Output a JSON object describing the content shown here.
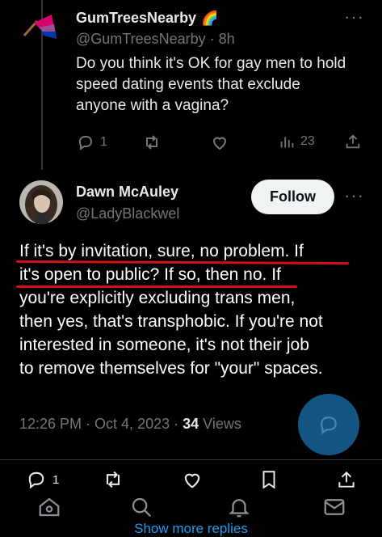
{
  "parent_tweet": {
    "display_name": "GumTreesNearby",
    "name_emoji": "🌈",
    "handle": "@GumTreesNearby",
    "time": "8h",
    "text": "Do you think it's OK for gay men to hold speed dating events that exclude anyone with a vagina?",
    "replies": "1",
    "views": "23",
    "more": "···"
  },
  "main_tweet": {
    "display_name": "Dawn McAuley",
    "handle": "@LadyBlackwel",
    "follow_label": "Follow",
    "more": "···",
    "text_lines": [
      "If it's by invitation, sure, no problem. If",
      "it's open to public? If so, then no. If",
      "you're explicitly excluding trans men,",
      "then yes, that's transphobic. If you're not",
      "interested in someone, it's not their job",
      "to remove themselves for \"your\" spaces."
    ],
    "time": "12:26 PM",
    "date": "Oct 4, 2023",
    "views_count": "34",
    "views_label": "Views",
    "replies": "1"
  },
  "show_more": "Show more replies",
  "colors": {
    "accent": "#1d9bf0",
    "underline": "#d40f16",
    "muted": "#71767b"
  }
}
